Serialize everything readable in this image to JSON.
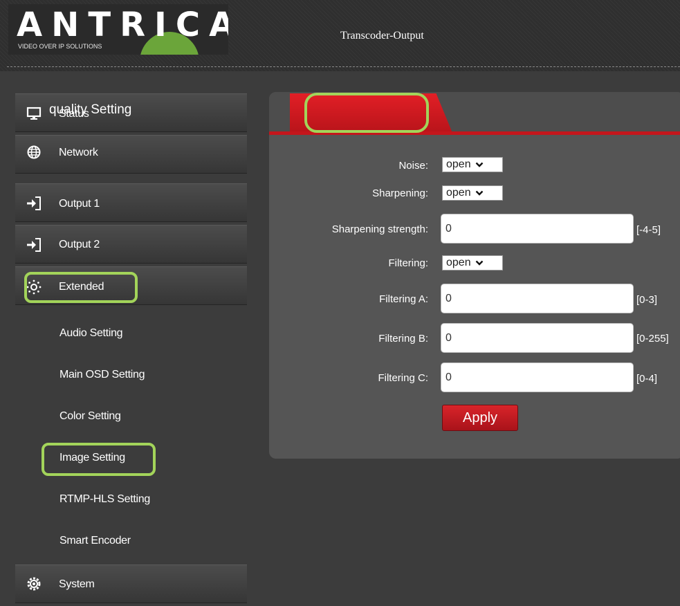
{
  "header": {
    "logo_text": "ANTRICA",
    "logo_tagline": "VIDEO OVER IP SOLUTIONS",
    "page_title": "Transcoder-Output"
  },
  "sidebar": {
    "items": [
      {
        "label": "Status",
        "icon": "monitor-icon"
      },
      {
        "label": "Network",
        "icon": "globe-icon"
      },
      {
        "label": "Output 1",
        "icon": "output-arrow-icon"
      },
      {
        "label": "Output 2",
        "icon": "output-arrow-icon"
      },
      {
        "label": "Extended",
        "icon": "extended-gear-icon",
        "expanded": true
      },
      {
        "label": "System",
        "icon": "system-gear-icon"
      }
    ],
    "submenu": [
      {
        "label": "Audio Setting"
      },
      {
        "label": "Main OSD Setting"
      },
      {
        "label": "Color Setting"
      },
      {
        "label": "Image Setting",
        "active": true
      },
      {
        "label": "RTMP-HLS Setting"
      },
      {
        "label": "Smart Encoder"
      }
    ]
  },
  "main": {
    "tab": {
      "label": "quality Setting"
    },
    "fields": {
      "noise": {
        "label": "Noise:",
        "value": "open"
      },
      "sharpening": {
        "label": "Sharpening:",
        "value": "open"
      },
      "sharpening_strength": {
        "label": "Sharpening strength:",
        "value": "0",
        "range": "[-4-5]"
      },
      "filtering": {
        "label": "Filtering:",
        "value": "open"
      },
      "filtering_a": {
        "label": "Filtering A:",
        "value": "0",
        "range": "[0-3]"
      },
      "filtering_b": {
        "label": "Filtering B:",
        "value": "0",
        "range": "[0-255]"
      },
      "filtering_c": {
        "label": "Filtering C:",
        "value": "0",
        "range": "[0-4]"
      }
    },
    "apply_label": "Apply"
  },
  "colors": {
    "accent_red": "#c4161c",
    "highlight_green": "#a3d45a",
    "logo_green": "#6ba53a",
    "background": "#3c3c3c"
  }
}
